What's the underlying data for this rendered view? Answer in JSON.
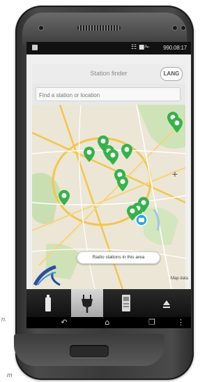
{
  "status_bar": {
    "signal": "☷ ■✁",
    "time": "990.08:17"
  },
  "app_bar": {
    "title": "Station finder",
    "language_button": "LANG"
  },
  "search": {
    "placeholder": "Find a station or location"
  },
  "map": {
    "popup_text": "Radio stations in this area",
    "copyright": "Map data"
  },
  "tabs": [
    {
      "icon": "bottle-icon",
      "active": false
    },
    {
      "icon": "plug-icon",
      "active": true
    },
    {
      "icon": "charging-station-icon",
      "active": false
    },
    {
      "icon": "eject-icon",
      "active": false
    }
  ],
  "colors": {
    "marker_green": "#35b24a",
    "current_location": "#2aa7e0",
    "route_blue": "#2a4fa0"
  },
  "side_text": {
    "a": "n.",
    "b": "m"
  }
}
